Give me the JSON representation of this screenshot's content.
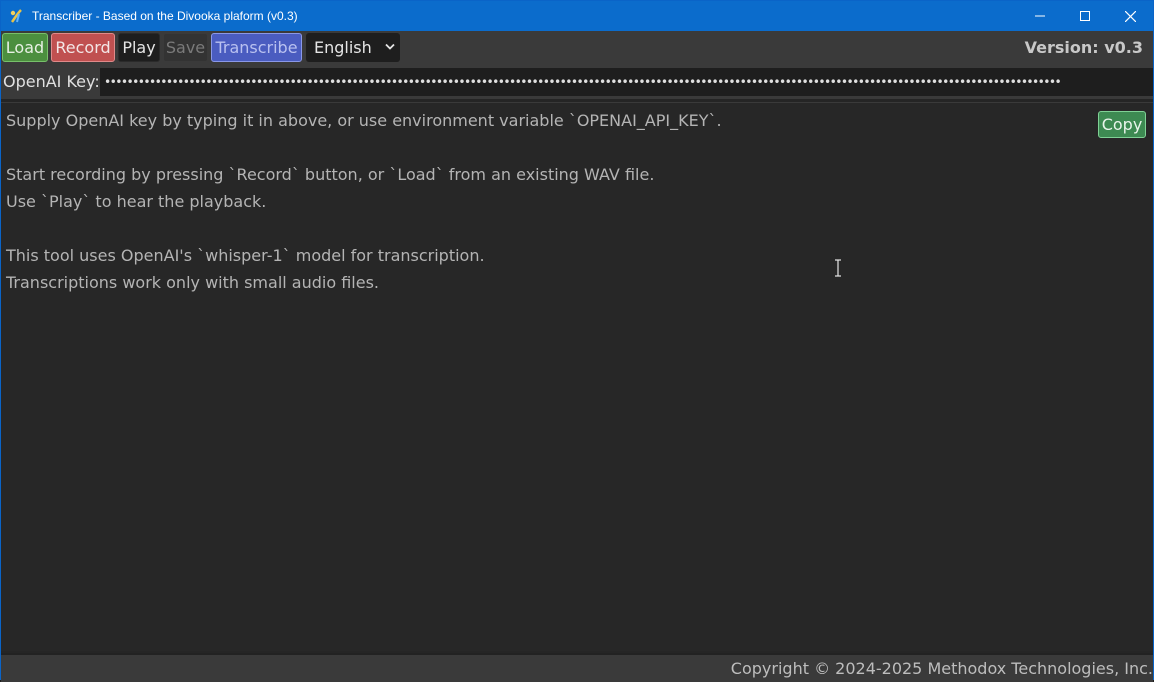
{
  "window": {
    "title": "Transcriber - Based on the Divooka plaform (v0.3)",
    "controls": {
      "minimize": "minimize-icon",
      "maximize": "maximize-icon",
      "close": "close-icon"
    }
  },
  "toolbar": {
    "load_label": "Load",
    "record_label": "Record",
    "play_label": "Play",
    "save_label": "Save",
    "transcribe_label": "Transcribe",
    "language": {
      "selected": "English"
    },
    "version_text": "Version: v0.3"
  },
  "apikey": {
    "label": "OpenAI Key:",
    "masked_value": "••••••••••••••••••••••••••••••••••••••••••••••••••••••••••••••••••••••••••••••••••••••••••••••••••••••••••••••••••••••••••••••••••••••••••••••••••••••••••••••••••••••••••"
  },
  "main": {
    "lines": [
      "Supply OpenAI key by typing it in above, or use environment variable `OPENAI_API_KEY`.",
      "",
      "Start recording by pressing `Record` button, or `Load` from an existing WAV file.",
      "Use `Play` to hear the playback.",
      "",
      "This tool uses OpenAI's `whisper-1` model for transcription.",
      "Transcriptions work only with small audio files."
    ],
    "copy_label": "Copy"
  },
  "footer": {
    "copyright": "Copyright © 2024-2025 Methodox Technologies, Inc."
  },
  "colors": {
    "titlebar": "#0b6ccc",
    "load": "#4c8f3f",
    "record": "#c05050",
    "transcribe": "#4a5cc0",
    "copy": "#3d8a52"
  }
}
